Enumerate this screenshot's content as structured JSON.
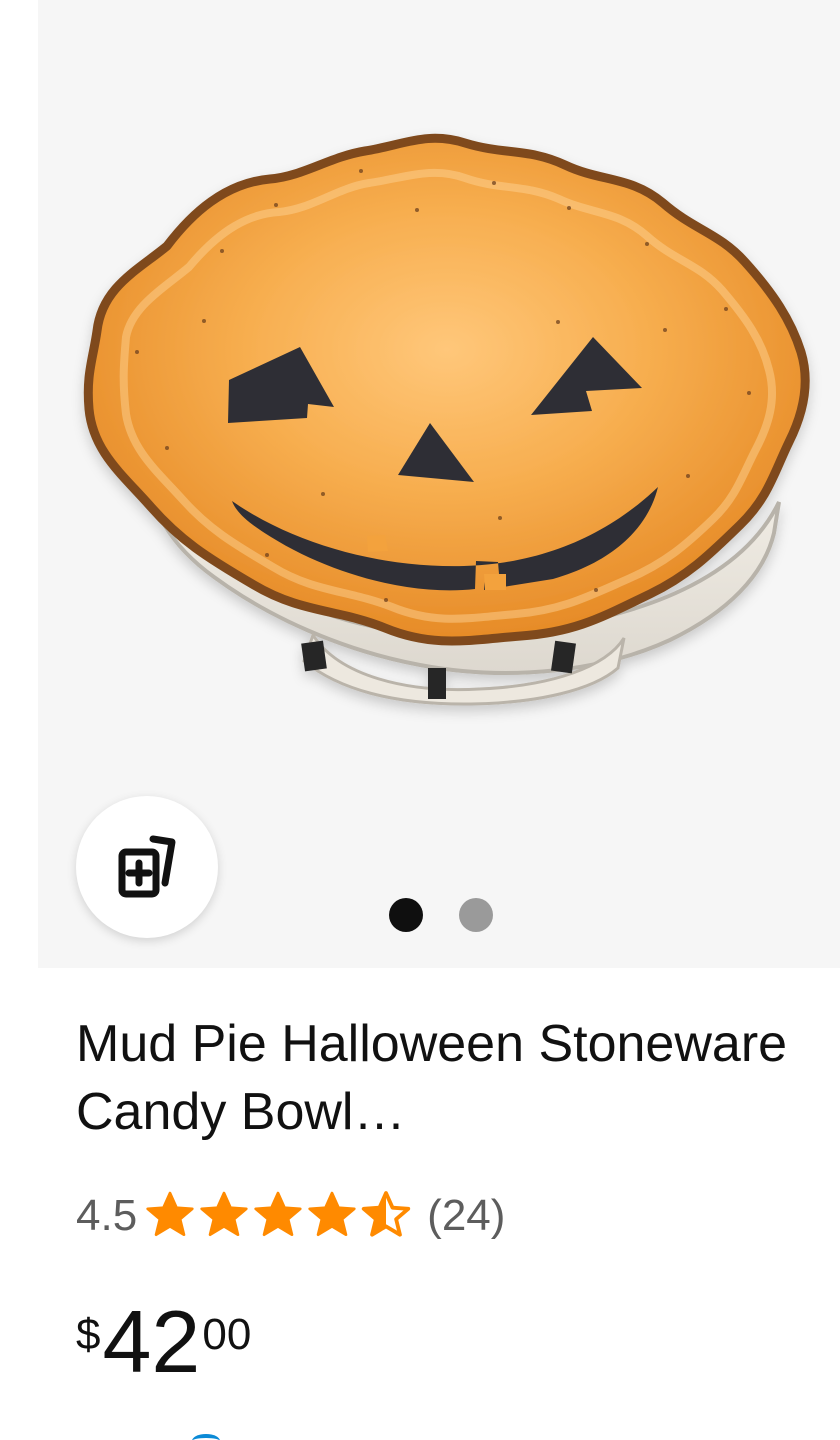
{
  "product": {
    "title": "Mud Pie Halloween Stoneware Candy Bowl…",
    "rating_value": "4.5",
    "rating_out_of_5": 4.5,
    "review_count": "(24)",
    "price": {
      "symbol": "$",
      "whole": "42",
      "fraction": "00"
    },
    "gallery": {
      "current_page": 1,
      "total_pages": 2
    }
  },
  "icons": {
    "compare": "compare-cards-icon",
    "star_full": "star-full-icon",
    "star_half": "star-half-icon"
  },
  "colors": {
    "star": "#ff8a00",
    "active_dot": "#0f0f0f",
    "inactive_dot": "#9a9a9a",
    "image_background": "#f6f6f6",
    "bowl_orange": "#f3a23c",
    "face_black": "#2f2f34"
  }
}
